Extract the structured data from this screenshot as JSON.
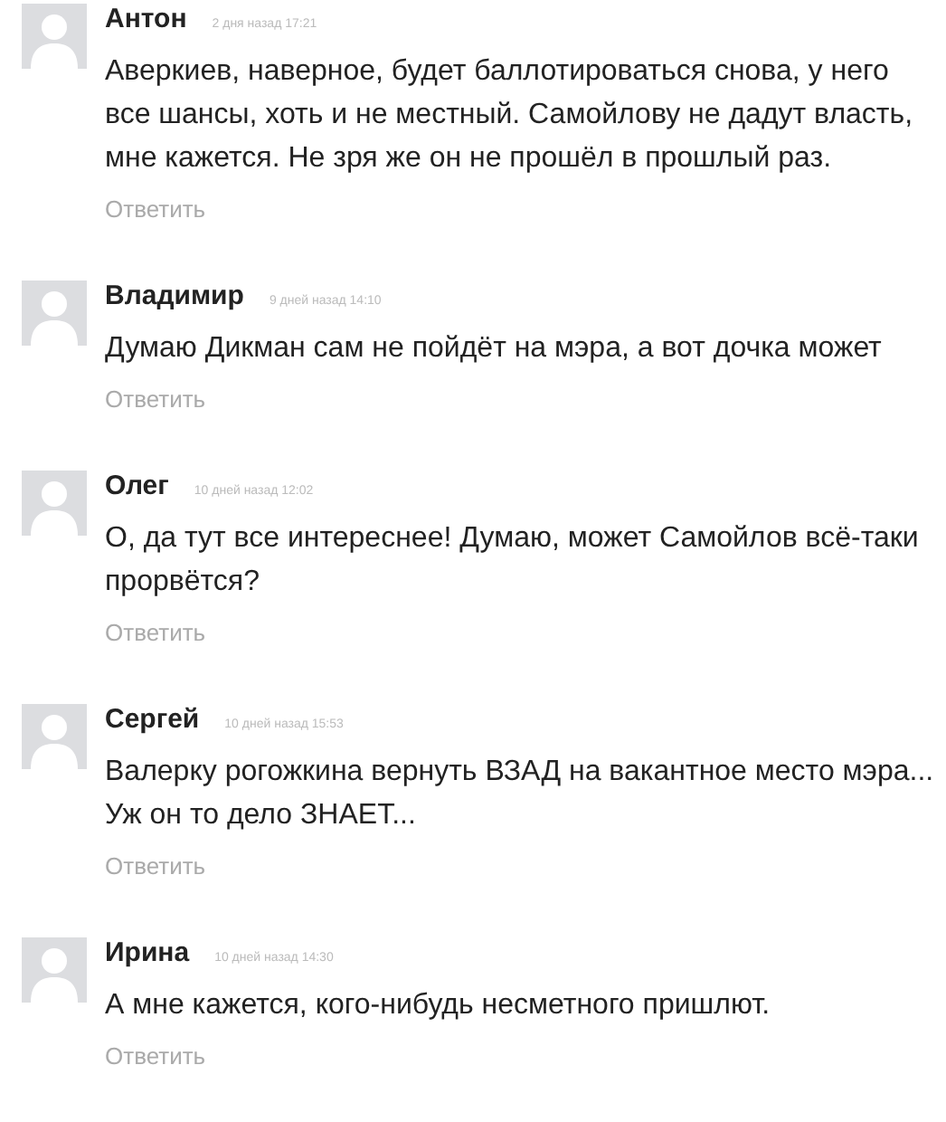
{
  "comments": [
    {
      "author": "Антон",
      "time": "2 дня назад 17:21",
      "text": "Аверкиев, наверное, будет баллотироваться снова, у него все шансы, хоть и не местный. Самойлову не дадут власть, мне кажется. Не зря же он не прошёл в прошлый раз.",
      "reply": "Ответить"
    },
    {
      "author": "Владимир",
      "time": "9 дней назад 14:10",
      "text": "Думаю Дикман сам не пойдёт на мэра, а вот дочка может",
      "reply": "Ответить"
    },
    {
      "author": "Олег",
      "time": "10 дней назад 12:02",
      "text": "О, да тут все интереснее! Думаю, может Самойлов всё-таки прорвётся?",
      "reply": "Ответить"
    },
    {
      "author": "Сергей",
      "time": "10 дней назад 15:53",
      "text": "Валерку рогожкина вернуть ВЗАД на вакантное место мэра... Уж он то дело ЗНАЕТ...",
      "reply": "Ответить"
    },
    {
      "author": "Ирина",
      "time": "10 дней назад 14:30",
      "text": "А мне кажется, кого-нибудь несметного пришлют.",
      "reply": "Ответить"
    }
  ]
}
